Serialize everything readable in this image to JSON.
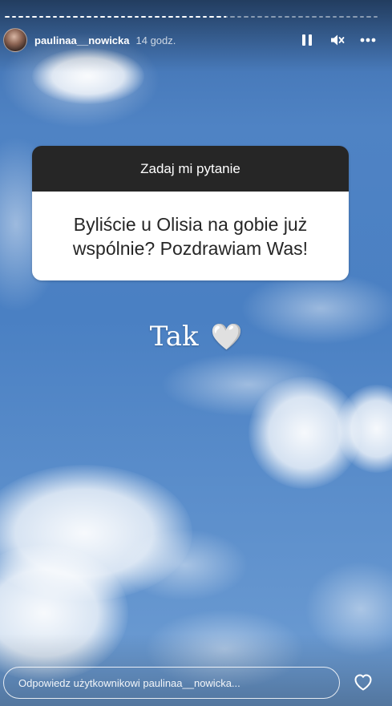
{
  "story": {
    "progress_segments": [
      {
        "state": "done"
      },
      {
        "state": "done"
      },
      {
        "state": "done"
      },
      {
        "state": "done"
      },
      {
        "state": "done"
      },
      {
        "state": "done"
      },
      {
        "state": "done"
      },
      {
        "state": "done"
      },
      {
        "state": "done"
      },
      {
        "state": "done"
      },
      {
        "state": "done"
      },
      {
        "state": "done"
      },
      {
        "state": "done"
      },
      {
        "state": "done"
      },
      {
        "state": "done"
      },
      {
        "state": "done"
      },
      {
        "state": "done"
      },
      {
        "state": "done"
      },
      {
        "state": "done"
      },
      {
        "state": "done"
      },
      {
        "state": "done"
      },
      {
        "state": "done"
      },
      {
        "state": "done"
      },
      {
        "state": "done"
      },
      {
        "state": "done"
      },
      {
        "state": "done"
      },
      {
        "state": "done"
      },
      {
        "state": "done"
      },
      {
        "state": "done"
      },
      {
        "state": "done"
      },
      {
        "state": "done"
      },
      {
        "state": "done"
      },
      {
        "state": "partial"
      },
      {
        "state": "todo"
      },
      {
        "state": "todo"
      },
      {
        "state": "todo"
      },
      {
        "state": "todo"
      },
      {
        "state": "todo"
      },
      {
        "state": "todo"
      },
      {
        "state": "todo"
      },
      {
        "state": "todo"
      },
      {
        "state": "todo"
      },
      {
        "state": "todo"
      },
      {
        "state": "todo"
      },
      {
        "state": "todo"
      },
      {
        "state": "todo"
      },
      {
        "state": "todo"
      },
      {
        "state": "todo"
      },
      {
        "state": "todo"
      },
      {
        "state": "todo"
      },
      {
        "state": "todo"
      },
      {
        "state": "todo"
      },
      {
        "state": "todo"
      },
      {
        "state": "todo"
      },
      {
        "state": "todo"
      }
    ]
  },
  "header": {
    "username": "paulinaa__nowicka",
    "time": "14 godz.",
    "icons": [
      "pause-icon",
      "mute-icon",
      "more-icon"
    ]
  },
  "question": {
    "title": "Zadaj mi pytanie",
    "text": "Byliście u Olisia na gobie już wspólnie? Pozdrawiam Was!"
  },
  "answer": {
    "text": "Tak",
    "emoji": "🤍"
  },
  "footer": {
    "reply_placeholder": "Odpowiedz użytkownikowi paulinaa__nowicka...",
    "like_icon": "heart-icon"
  },
  "colors": {
    "card_header": "#262626",
    "card_body": "#ffffff",
    "sky": "#4a80c3"
  }
}
